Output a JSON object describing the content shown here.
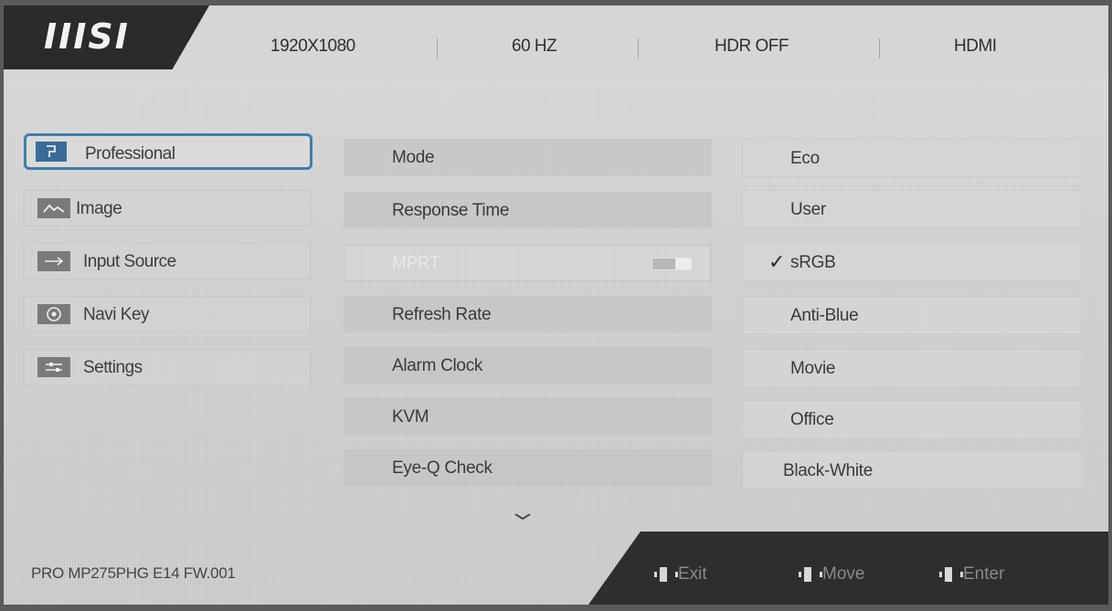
{
  "header": {
    "logo": "IIISI",
    "resolution": "1920X1080",
    "refresh": "60 HZ",
    "hdr": "HDR OFF",
    "input": "HDMI"
  },
  "menu": {
    "items": [
      {
        "label": "Professional",
        "icon": "professional-icon",
        "active": true
      },
      {
        "label": "Image",
        "icon": "image-icon"
      },
      {
        "label": "Input Source",
        "icon": "arrow-right-icon"
      },
      {
        "label": "Navi Key",
        "icon": "joystick-icon"
      },
      {
        "label": "Settings",
        "icon": "sliders-icon"
      }
    ]
  },
  "options": {
    "items": [
      {
        "label": "Mode"
      },
      {
        "label": "Response Time"
      },
      {
        "label": "MPRT",
        "disabled": true,
        "toggle": "off"
      },
      {
        "label": "Refresh Rate"
      },
      {
        "label": "Alarm Clock"
      },
      {
        "label": "KVM"
      },
      {
        "label": "Eye-Q Check"
      }
    ],
    "more_icon": "chevron-down-icon"
  },
  "modes": {
    "items": [
      {
        "label": "Eco"
      },
      {
        "label": "User"
      },
      {
        "label": "sRGB",
        "selected": true
      },
      {
        "label": "Anti-Blue"
      },
      {
        "label": "Movie"
      },
      {
        "label": "Office"
      },
      {
        "label": "Black-White"
      }
    ],
    "check_mark": "✓"
  },
  "footer": {
    "model": "PRO MP275PHG E14  FW.001",
    "exit": "Exit",
    "move": "Move",
    "enter": "Enter"
  },
  "colors": {
    "accent": "#3f7fa8",
    "dark_panel": "#2e2e2e"
  }
}
